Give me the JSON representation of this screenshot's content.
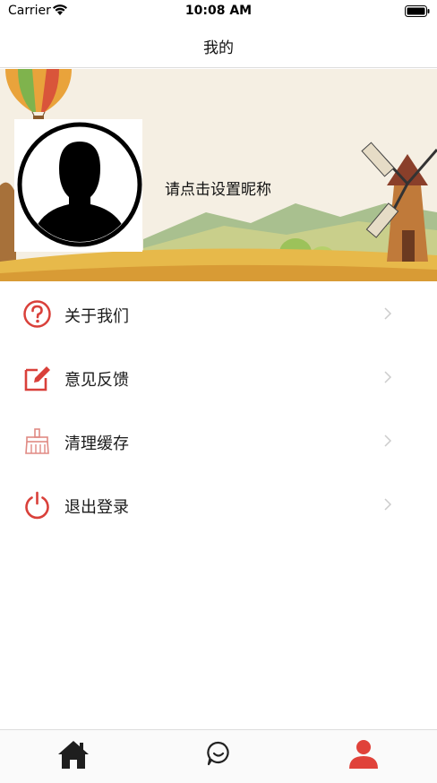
{
  "status_bar": {
    "carrier": "Carrier",
    "time": "10:08 AM"
  },
  "nav": {
    "title": "我的"
  },
  "profile": {
    "nickname_prompt": "请点击设置昵称"
  },
  "menu": {
    "items": [
      {
        "label": "关于我们",
        "icon": "question-circle-icon"
      },
      {
        "label": "意见反馈",
        "icon": "edit-icon"
      },
      {
        "label": "清理缓存",
        "icon": "broom-icon"
      },
      {
        "label": "退出登录",
        "icon": "power-icon"
      }
    ]
  },
  "tab_bar": {
    "tabs": [
      {
        "icon": "home-icon",
        "active": false
      },
      {
        "icon": "chat-icon",
        "active": false
      },
      {
        "icon": "person-icon",
        "active": true
      }
    ],
    "active_color": "#e0423a",
    "inactive_color": "#222222"
  },
  "colors": {
    "accent": "#d9403a"
  }
}
